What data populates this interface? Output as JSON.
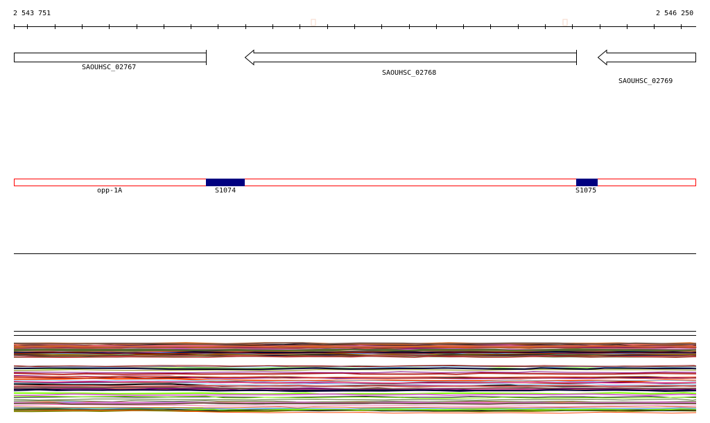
{
  "ruler": {
    "start_label": "2 543 751",
    "end_label": "2 546 250"
  },
  "genes": [
    {
      "name": "SAOUHSC_02767",
      "strand": "+"
    },
    {
      "name": "SAOUHSC_02768",
      "strand": "-"
    },
    {
      "name": "SAOUHSC_02769",
      "strand": "-"
    }
  ],
  "regions": {
    "operon": "opp-1A",
    "srna1": "S1074",
    "srna2": "S1075"
  },
  "colors": {
    "region_outline": "#ff0000",
    "srna_fill": "#000080",
    "marker": "#f5d7c8"
  },
  "expression_palette": [
    "#b22222",
    "#000000",
    "#808000",
    "#ff69b4",
    "#7cfc00",
    "#ff7f50",
    "#d2691e",
    "#8b0000",
    "#87cefa",
    "#6495ed",
    "#800080",
    "#000033",
    "#cd5c5c",
    "#556b2f",
    "#795548",
    "#da70d6",
    "#ff4500",
    "#a0522d"
  ]
}
